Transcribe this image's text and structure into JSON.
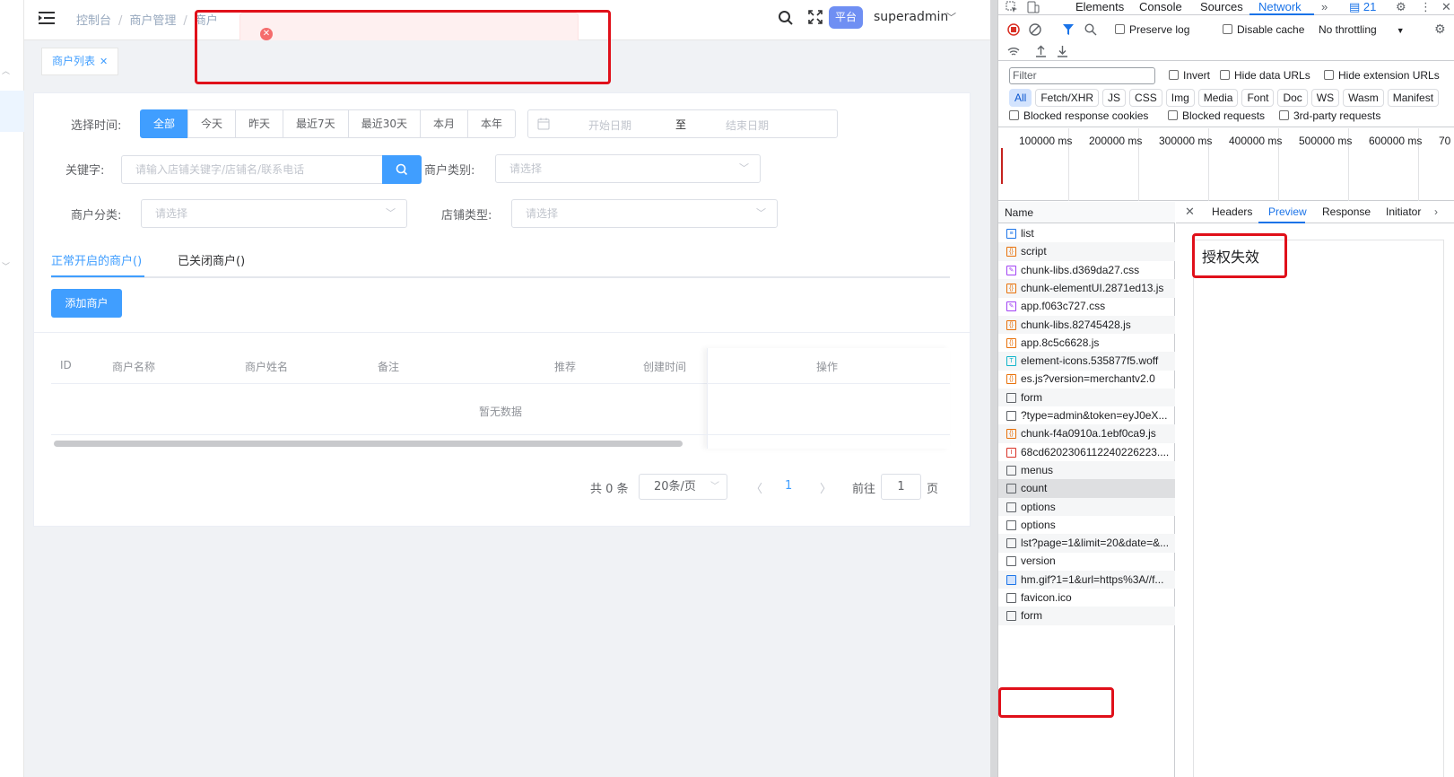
{
  "app": {
    "breadcrumb": [
      "控制台",
      "商户管理",
      "商户"
    ],
    "platform_badge": "平台",
    "username": "superadmin",
    "tag": "商户列表",
    "filters": {
      "time_label": "选择时间:",
      "time_options": [
        "全部",
        "今天",
        "昨天",
        "最近7天",
        "最近30天",
        "本月",
        "本年"
      ],
      "date_start": "开始日期",
      "date_to": "至",
      "date_end": "结束日期",
      "keyword_label": "关键字:",
      "keyword_placeholder": "请输入店铺关键字/店铺名/联系电话",
      "merchant_type_label": "商户类别:",
      "merchant_category_label": "商户分类:",
      "shop_type_label": "店铺类型:",
      "select_placeholder": "请选择"
    },
    "tabs": [
      "正常开启的商户()",
      "已关闭商户()"
    ],
    "add_button": "添加商户",
    "table": {
      "columns": [
        "ID",
        "商户名称",
        "商户姓名",
        "备注",
        "推荐",
        "创建时间",
        "操作"
      ],
      "empty": "暂无数据"
    },
    "pagination": {
      "total": "共 0 条",
      "page_size": "20条/页",
      "current": "1",
      "goto": "前往",
      "goto_value": "1",
      "page_suffix": "页"
    }
  },
  "devtools": {
    "tabs": [
      "Elements",
      "Console",
      "Sources",
      "Network"
    ],
    "issues_count": "21",
    "preserve_log": "Preserve log",
    "disable_cache": "Disable cache",
    "throttling": "No throttling",
    "filter_placeholder": "Filter",
    "invert": "Invert",
    "hide_data_urls": "Hide data URLs",
    "hide_extension_urls": "Hide extension URLs",
    "types": [
      "All",
      "Fetch/XHR",
      "JS",
      "CSS",
      "Img",
      "Media",
      "Font",
      "Doc",
      "WS",
      "Wasm",
      "Manifest"
    ],
    "blocked_cookies": "Blocked response cookies",
    "blocked_requests": "Blocked requests",
    "third_party": "3rd-party requests",
    "timeline_ticks": [
      "100000 ms",
      "200000 ms",
      "300000 ms",
      "400000 ms",
      "500000 ms",
      "600000 ms",
      "70"
    ],
    "name_header": "Name",
    "requests": [
      {
        "name": "list",
        "kind": "doc"
      },
      {
        "name": "script",
        "kind": "js"
      },
      {
        "name": "chunk-libs.d369da27.css",
        "kind": "css"
      },
      {
        "name": "chunk-elementUI.2871ed13.js",
        "kind": "js"
      },
      {
        "name": "app.f063c727.css",
        "kind": "css"
      },
      {
        "name": "chunk-libs.82745428.js",
        "kind": "js"
      },
      {
        "name": "app.8c5c6628.js",
        "kind": "js"
      },
      {
        "name": "element-icons.535877f5.woff",
        "kind": "font"
      },
      {
        "name": "es.js?version=merchantv2.0",
        "kind": "js"
      },
      {
        "name": "form",
        "kind": "xhr"
      },
      {
        "name": "?type=admin&token=eyJ0eX...",
        "kind": "xhr"
      },
      {
        "name": "chunk-f4a0910a.1ebf0ca9.js",
        "kind": "js"
      },
      {
        "name": "68cd6202306112240226223....",
        "kind": "img"
      },
      {
        "name": "menus",
        "kind": "xhr"
      },
      {
        "name": "count",
        "kind": "xhr"
      },
      {
        "name": "options",
        "kind": "xhr"
      },
      {
        "name": "options",
        "kind": "xhr"
      },
      {
        "name": "lst?page=1&limit=20&date=&...",
        "kind": "xhr"
      },
      {
        "name": "version",
        "kind": "xhr"
      },
      {
        "name": "hm.gif?1=1&url=https%3A//f...",
        "kind": "gif"
      },
      {
        "name": "favicon.ico",
        "kind": "xhr"
      },
      {
        "name": "form",
        "kind": "xhr"
      }
    ],
    "detail_tabs": [
      "Headers",
      "Preview",
      "Response",
      "Initiator"
    ],
    "preview_text": "授权失效"
  }
}
